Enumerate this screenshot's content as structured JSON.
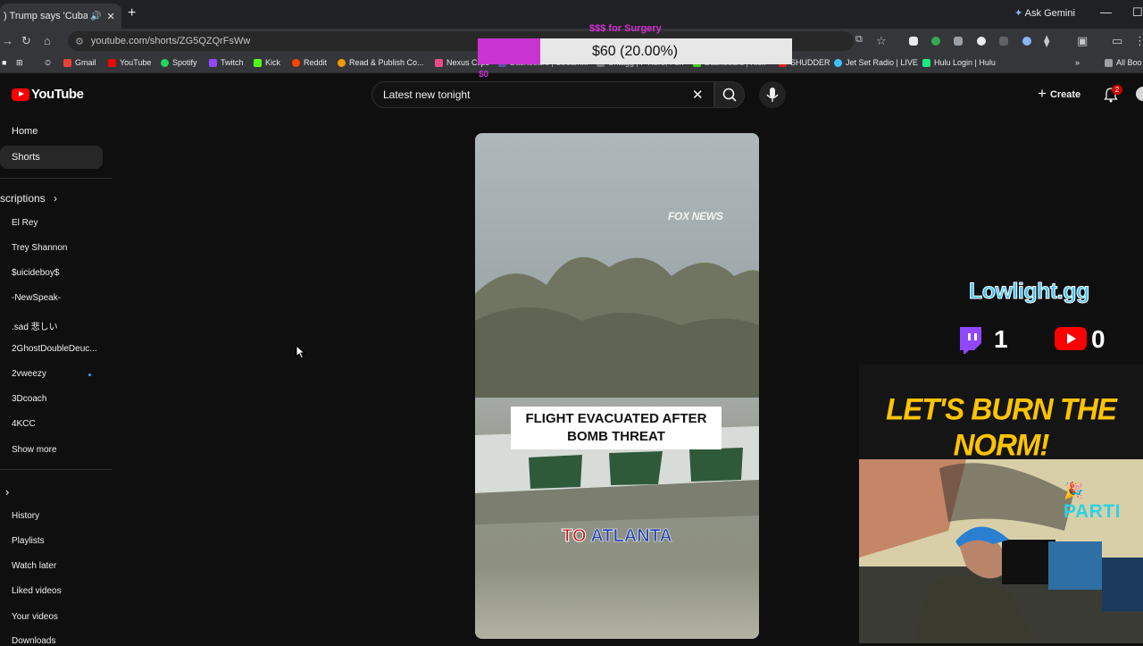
{
  "browser": {
    "tab_title": ") Trump says 'Cuba's gon",
    "url": "youtube.com/shorts/ZG5QZQrFsWw",
    "ask_gemini": "Ask Gemini",
    "bookmarks": [
      {
        "label": "Gmail",
        "color": "#ea4335"
      },
      {
        "label": "YouTube",
        "color": "#ff0000"
      },
      {
        "label": "Spotify",
        "color": "#1ed760"
      },
      {
        "label": "Twitch",
        "color": "#9146ff"
      },
      {
        "label": "Kick",
        "color": "#53fc18"
      },
      {
        "label": "Reddit",
        "color": "#ff4500"
      },
      {
        "label": "Read & Publish Co...",
        "color": "#f29900"
      },
      {
        "label": "Nexus Clips",
        "color": "#e84b8a"
      },
      {
        "label": "Dashboard | Stream...",
        "color": "#6a5acd"
      },
      {
        "label": "Untagg | F Here, Fun",
        "color": "#888888"
      },
      {
        "label": "Dashboard | Kick",
        "color": "#53fc18"
      },
      {
        "label": "SHUDDER",
        "color": "#e01f26"
      },
      {
        "label": "Jet Set Radio | LIVE",
        "color": "#3ec2ff"
      },
      {
        "label": "Hulu Login | Hulu",
        "color": "#1ce783"
      },
      {
        "label": "All Boo",
        "color": "#9aa0a6"
      }
    ]
  },
  "donation": {
    "title": "$$$ for Surgery",
    "label": "$60 (20.00%)",
    "progress": 0.2,
    "amount": "$0"
  },
  "youtube": {
    "logo_text": "YouTube",
    "search_value": "Latest new tonight",
    "create_label": "Create",
    "notification_count": "2"
  },
  "sidebar": {
    "home": "Home",
    "shorts": "Shorts",
    "subscriptions_header": "scriptions",
    "subscriptions": [
      "El Rey",
      "Trey Shannon",
      "$uicideboy$",
      "-NewSpeak-",
      ".sad 悲しい",
      "2GhostDoubleDeuc...",
      "2vweezy",
      "3Dcoach",
      "4KCC"
    ],
    "show_more": "Show more",
    "you_items": [
      "History",
      "Playlists",
      "Watch later",
      "Liked videos",
      "Your videos",
      "Downloads"
    ]
  },
  "short": {
    "watermark": "FOX NEWS",
    "caption_line1": "FLIGHT EVACUATED AFTER",
    "caption_line2": "BOMB THREAT",
    "subtitle_word1": "TO",
    "subtitle_word2": "ATLANTA"
  },
  "overlay": {
    "brand": "Lowlight.gg",
    "twitch_count": "1",
    "youtube_count": "0",
    "motto": "LET'S BURN THE NORM!",
    "cam_banner": "PARTI"
  }
}
